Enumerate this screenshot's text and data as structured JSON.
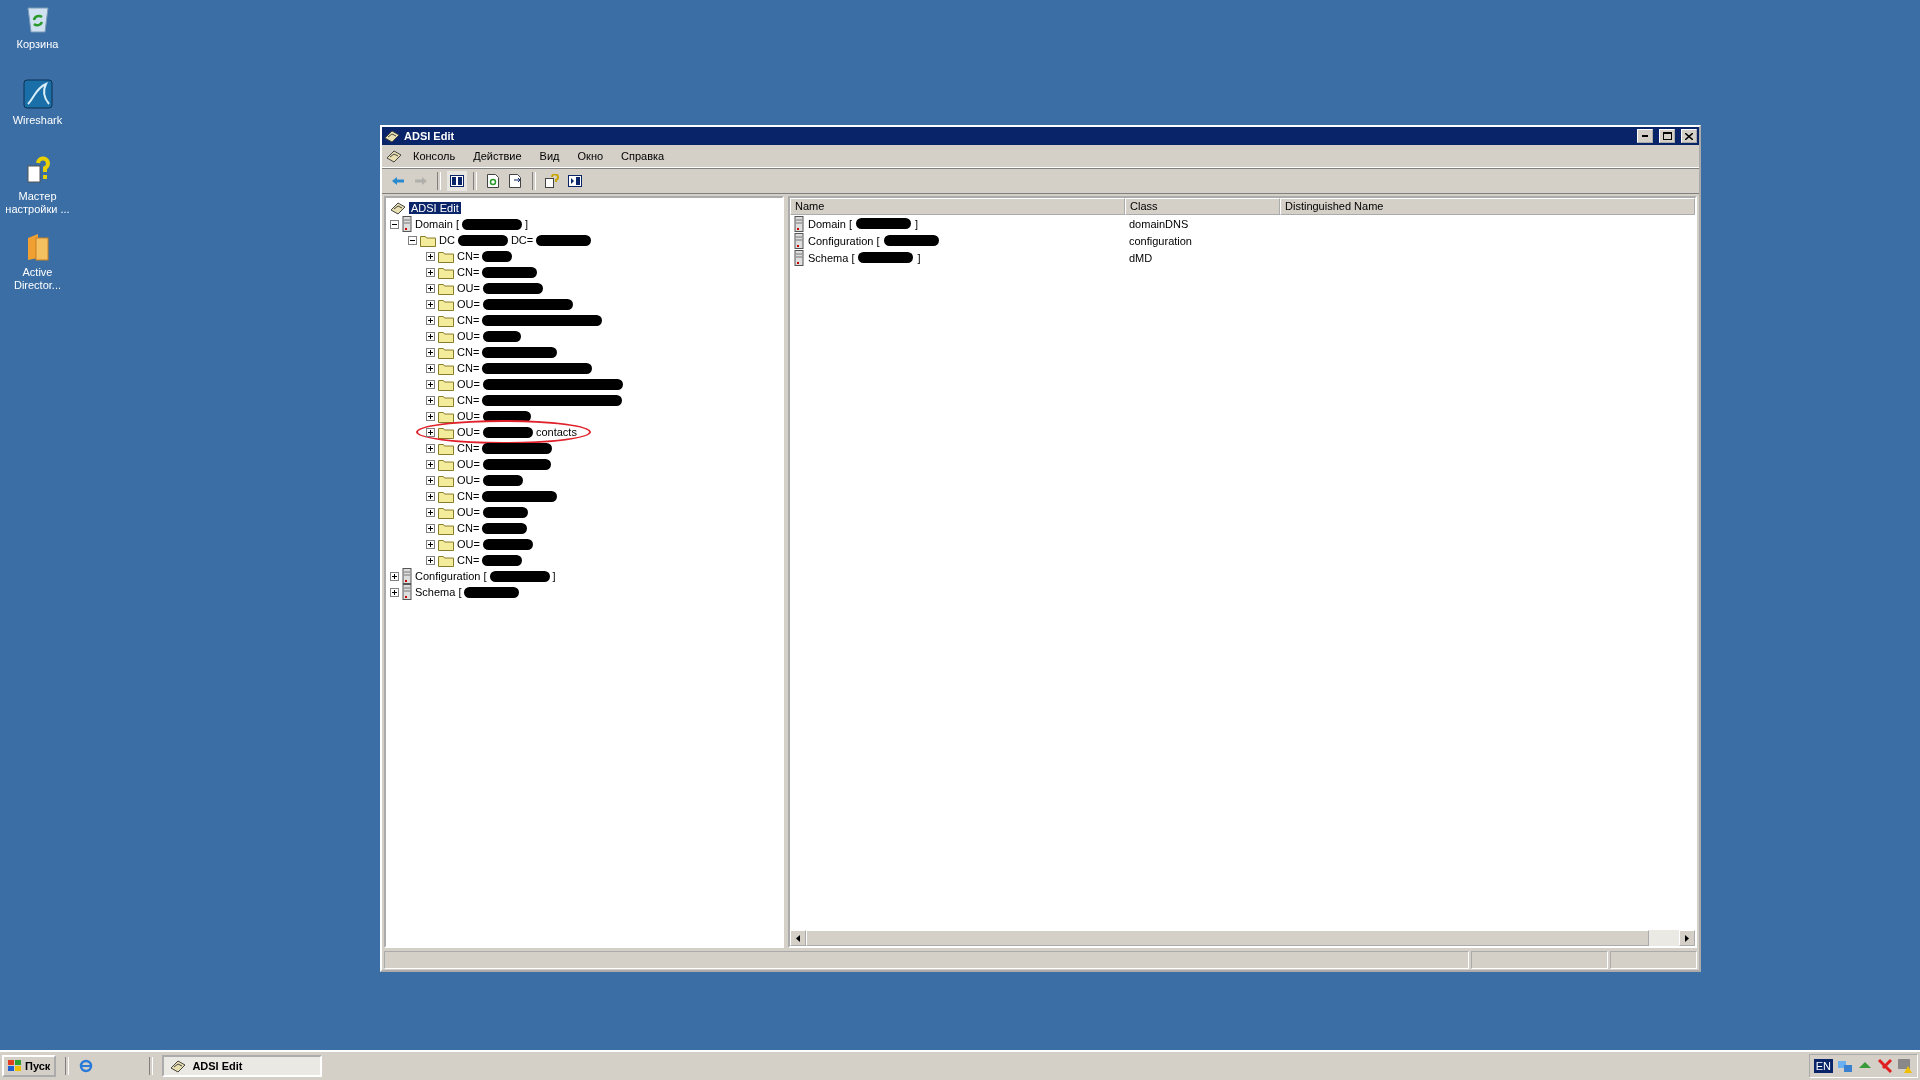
{
  "desktop_icons": [
    {
      "label": "Корзина",
      "kind": "recycle"
    },
    {
      "label": "Wireshark",
      "kind": "wireshark"
    },
    {
      "label": "Мастер настройки ...",
      "kind": "wizard"
    },
    {
      "label": "Active Director...",
      "kind": "folder"
    }
  ],
  "window": {
    "title": "ADSI Edit"
  },
  "menu": [
    "Консоль",
    "Действие",
    "Вид",
    "Окно",
    "Справка"
  ],
  "toolbar": [
    {
      "kind": "back",
      "disabled": false,
      "pressed": false
    },
    {
      "kind": "forward",
      "disabled": true,
      "pressed": false
    },
    {
      "kind": "tree",
      "disabled": false,
      "pressed": true
    },
    {
      "kind": "refresh",
      "disabled": false,
      "pressed": false
    },
    {
      "kind": "export",
      "disabled": false,
      "pressed": false
    },
    {
      "kind": "help",
      "disabled": false,
      "pressed": false
    },
    {
      "kind": "panel",
      "disabled": false,
      "pressed": false
    }
  ],
  "tree": {
    "label": "ADSI Edit",
    "selected": true,
    "children": [
      {
        "kind": "server",
        "parts": [
          "Domain [",
          "]"
        ],
        "trailing_redaction": false,
        "expanded": true,
        "children": [
          {
            "kind": "folder",
            "parts": [
              "DC",
              "DC="
            ],
            "trailing_redaction": true,
            "expanded": true,
            "children": [
              {
                "kind": "folder",
                "parts": [
                  "CN="
                ],
                "trailing_redaction": true,
                "expanded": false
              },
              {
                "kind": "folder",
                "parts": [
                  "CN="
                ],
                "trailing_redaction": true,
                "expanded": false
              },
              {
                "kind": "folder",
                "parts": [
                  "OU="
                ],
                "trailing_redaction": true,
                "expanded": false
              },
              {
                "kind": "folder",
                "parts": [
                  "OU="
                ],
                "trailing_redaction": true,
                "expanded": false
              },
              {
                "kind": "folder",
                "parts": [
                  "CN="
                ],
                "trailing_redaction": true,
                "expanded": false
              },
              {
                "kind": "folder",
                "parts": [
                  "OU="
                ],
                "trailing_redaction": true,
                "expanded": false
              },
              {
                "kind": "folder",
                "parts": [
                  "CN="
                ],
                "trailing_redaction": true,
                "expanded": false
              },
              {
                "kind": "folder",
                "parts": [
                  "CN="
                ],
                "trailing_redaction": true,
                "expanded": false
              },
              {
                "kind": "folder",
                "parts": [
                  "OU="
                ],
                "trailing_redaction": true,
                "expanded": false
              },
              {
                "kind": "folder",
                "parts": [
                  "CN="
                ],
                "trailing_redaction": true,
                "expanded": false
              },
              {
                "kind": "folder",
                "parts": [
                  "OU="
                ],
                "trailing_redaction": true,
                "expanded": false
              },
              {
                "kind": "folder",
                "parts": [
                  "OU=",
                  "contacts"
                ],
                "trailing_redaction": false,
                "expanded": false,
                "circled": true
              },
              {
                "kind": "folder",
                "parts": [
                  "CN="
                ],
                "trailing_redaction": true,
                "expanded": false
              },
              {
                "kind": "folder",
                "parts": [
                  "OU="
                ],
                "trailing_redaction": true,
                "expanded": false
              },
              {
                "kind": "folder",
                "parts": [
                  "OU="
                ],
                "trailing_redaction": true,
                "expanded": false
              },
              {
                "kind": "folder",
                "parts": [
                  "CN="
                ],
                "trailing_redaction": true,
                "expanded": false
              },
              {
                "kind": "folder",
                "parts": [
                  "OU="
                ],
                "trailing_redaction": true,
                "expanded": false
              },
              {
                "kind": "folder",
                "parts": [
                  "CN="
                ],
                "trailing_redaction": true,
                "expanded": false
              },
              {
                "kind": "folder",
                "parts": [
                  "OU="
                ],
                "trailing_redaction": true,
                "expanded": false
              },
              {
                "kind": "folder",
                "parts": [
                  "CN="
                ],
                "trailing_redaction": true,
                "expanded": false
              }
            ]
          }
        ]
      },
      {
        "kind": "server",
        "parts": [
          "Configuration [",
          "]"
        ],
        "trailing_redaction": false,
        "expanded": false
      },
      {
        "kind": "server",
        "parts": [
          "Schema ["
        ],
        "trailing_redaction": true,
        "expanded": false
      }
    ]
  },
  "list": {
    "columns": [
      "Name",
      "Class",
      "Distinguished Name"
    ],
    "rows": [
      {
        "parts": [
          "Domain [",
          "]"
        ],
        "trailing_redaction": false,
        "class": "domainDNS"
      },
      {
        "parts": [
          "Configuration ["
        ],
        "trailing_redaction": true,
        "class": "configuration"
      },
      {
        "parts": [
          "Schema [",
          "]"
        ],
        "trailing_redaction": false,
        "class": "dMD"
      }
    ]
  },
  "taskbar": {
    "start": "Пуск",
    "tasks": [
      {
        "label": "ADSI Edit",
        "selected": true
      }
    ],
    "language": "EN"
  }
}
